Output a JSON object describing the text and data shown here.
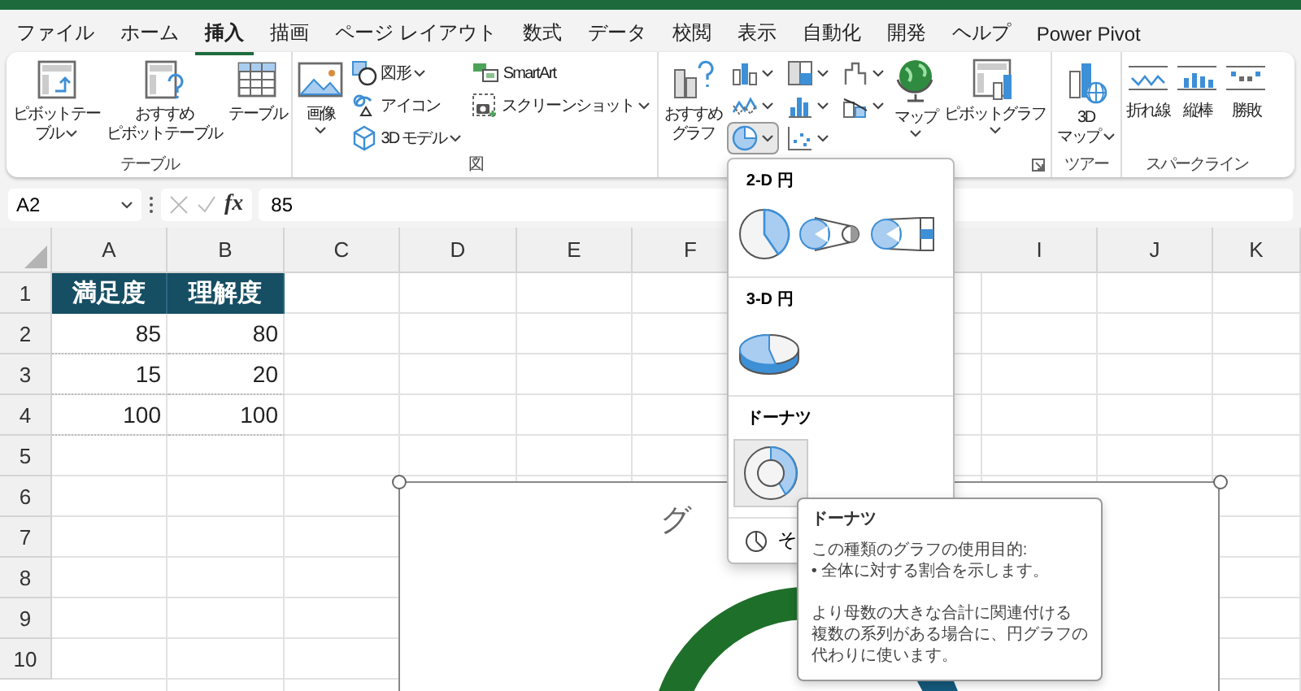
{
  "menu_tabs": [
    {
      "label": "ファイル",
      "selected": false
    },
    {
      "label": "ホーム",
      "selected": false
    },
    {
      "label": "挿入",
      "selected": true
    },
    {
      "label": "描画",
      "selected": false
    },
    {
      "label": "ページ レイアウト",
      "selected": false
    },
    {
      "label": "数式",
      "selected": false
    },
    {
      "label": "データ",
      "selected": false
    },
    {
      "label": "校閲",
      "selected": false
    },
    {
      "label": "表示",
      "selected": false
    },
    {
      "label": "自動化",
      "selected": false
    },
    {
      "label": "開発",
      "selected": false
    },
    {
      "label": "ヘルプ",
      "selected": false
    },
    {
      "label": "Power Pivot",
      "selected": false
    }
  ],
  "ribbon": {
    "groups": [
      {
        "label": "テーブル",
        "columns": [
          {
            "kind": "large",
            "lines": [
              "ピボットテー",
              "ブル"
            ],
            "dropdown": true
          },
          {
            "kind": "large",
            "lines": [
              "おすすめ",
              "ピボットテーブル"
            ],
            "dropdown": false
          },
          {
            "kind": "large",
            "lines": [
              "テーブル"
            ],
            "dropdown": false
          }
        ]
      },
      {
        "label": "図",
        "columns": [
          {
            "kind": "large",
            "lines": [
              "画像"
            ],
            "dropdown": true
          },
          {
            "kind": "stack",
            "items": [
              {
                "kind": "small",
                "label": "図形",
                "dropdown": true
              },
              {
                "kind": "small",
                "label": "アイコン",
                "dropdown": false
              },
              {
                "kind": "small",
                "label": "3D モデル",
                "dropdown": true
              }
            ]
          },
          {
            "kind": "stack",
            "items": [
              {
                "kind": "small",
                "label": "SmartArt",
                "dropdown": false
              },
              {
                "kind": "small",
                "label": "スクリーンショット",
                "dropdown": true
              }
            ]
          }
        ]
      },
      {
        "launcher": true,
        "columns": [
          {
            "kind": "large",
            "lines": [
              "おすすめ",
              "グラフ"
            ],
            "dropdown": false
          },
          {
            "kind": "stack",
            "items": [
              {
                "kind": "chart",
                "selected": false
              },
              {
                "kind": "chart",
                "selected": false
              },
              {
                "kind": "chart",
                "selected": true
              }
            ]
          },
          {
            "kind": "stack",
            "items": [
              {
                "kind": "chart",
                "selected": false
              },
              {
                "kind": "chart",
                "selected": false
              },
              {
                "kind": "chart",
                "selected": false
              }
            ]
          },
          {
            "kind": "stack",
            "items": [
              {
                "kind": "chart",
                "selected": false
              },
              {
                "kind": "chart",
                "selected": false
              }
            ]
          },
          {
            "kind": "large",
            "lines": [
              "マップ"
            ],
            "dropdown": true
          },
          {
            "kind": "large",
            "lines": [
              "ピボットグラフ"
            ],
            "dropdown": true
          }
        ]
      },
      {
        "label": "ツアー",
        "columns": [
          {
            "kind": "large",
            "lines": [
              "3D",
              "マップ"
            ],
            "dropdown": true
          }
        ]
      },
      {
        "label": "スパークライン",
        "columns": [
          {
            "kind": "large",
            "lines": [
              "折れ線"
            ],
            "dropdown": false
          },
          {
            "kind": "large",
            "lines": [
              "縦棒"
            ],
            "dropdown": false
          },
          {
            "kind": "large",
            "lines": [
              "勝敗"
            ],
            "dropdown": false
          }
        ]
      }
    ]
  },
  "formula_bar": {
    "name_box": "A2",
    "fx": "fx",
    "formula": "85"
  },
  "sheet": {
    "columns": [
      "A",
      "B",
      "C",
      "D",
      "E",
      "F",
      "I",
      "J",
      "K"
    ],
    "rows": [
      {
        "header": "1",
        "kind": "header",
        "cells": [
          "満足度",
          "理解度"
        ]
      },
      {
        "header": "2",
        "kind": "value",
        "cells": [
          "85",
          "80"
        ]
      },
      {
        "header": "3",
        "kind": "value",
        "cells": [
          "15",
          "20"
        ]
      },
      {
        "header": "4",
        "kind": "value",
        "cells": [
          "100",
          "100"
        ]
      },
      {
        "header": "5"
      },
      {
        "header": "6"
      },
      {
        "header": "7"
      },
      {
        "header": "8"
      },
      {
        "header": "9"
      },
      {
        "header": "10"
      }
    ]
  },
  "chart": {
    "title": "グ"
  },
  "chart_menu": {
    "sections": [
      {
        "title": "2-D 円",
        "options": [
          {
            "selected": false
          },
          {
            "selected": false
          },
          {
            "selected": false
          }
        ]
      },
      {
        "title": "3-D 円",
        "options": [
          {
            "selected": false
          }
        ]
      },
      {
        "title": "ドーナツ",
        "options": [
          {
            "selected": true
          }
        ]
      }
    ],
    "more_label": "そ"
  },
  "tooltip": {
    "title": "ドーナツ",
    "lines": [
      "この種類のグラフの使用目的:",
      "• 全体に対する割合を示します。"
    ],
    "note_lines": [
      "より母数の大きな合計に関連付ける",
      "複数の系列がある場合に、円グラフの",
      "代わりに使います。"
    ]
  }
}
